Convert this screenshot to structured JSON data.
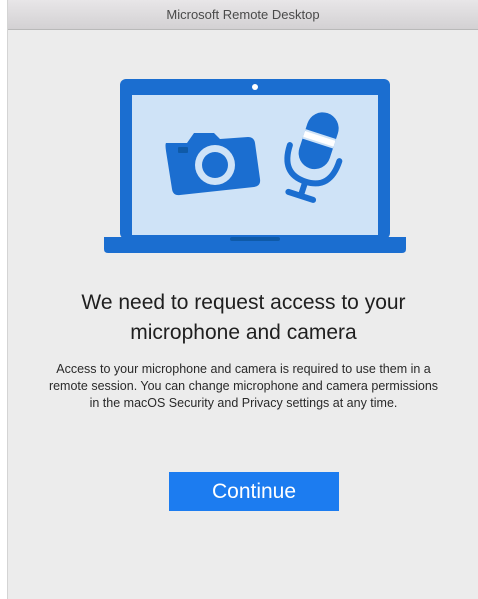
{
  "window": {
    "title": "Microsoft Remote Desktop"
  },
  "illustration": {
    "icons": [
      "laptop-icon",
      "camera-icon",
      "microphone-icon"
    ],
    "colors": {
      "frame": "#1b6ed0",
      "screen": "#cfe3f7",
      "dark": "#0f5aa8"
    }
  },
  "dialog": {
    "headline": "We need to request access to your microphone and camera",
    "body": "Access to your microphone and camera is required to use them in a remote session. You can change microphone and camera permissions in the macOS Security and Privacy settings at any time.",
    "continue_label": "Continue"
  },
  "colors": {
    "accent": "#1c7cf0",
    "background": "#ececec"
  }
}
